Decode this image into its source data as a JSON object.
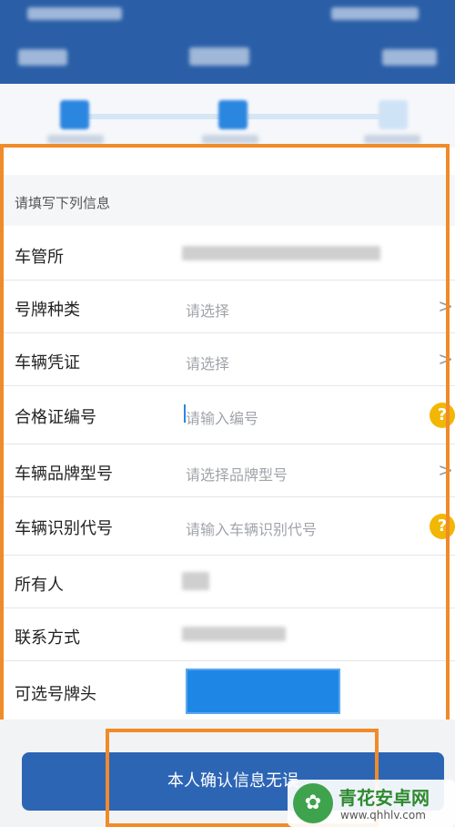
{
  "form": {
    "section_title": "请填写下列信息",
    "rows": [
      {
        "label": "车管所",
        "value": ""
      },
      {
        "label": "号牌种类",
        "value": "请选择"
      },
      {
        "label": "车辆凭证",
        "value": "请选择"
      },
      {
        "label": "合格证编号",
        "value": "请输入编号"
      },
      {
        "label": "车辆品牌型号",
        "value": "请选择品牌型号"
      },
      {
        "label": "车辆识别代号",
        "value": "请输入车辆识别代号"
      },
      {
        "label": "所有人",
        "value": ""
      },
      {
        "label": "联系方式",
        "value": ""
      },
      {
        "label": "可选号牌头",
        "value": ""
      }
    ],
    "chevron": ">",
    "help_symbol": "?"
  },
  "confirm_button": {
    "label": "本人确认信息无误"
  },
  "watermark": {
    "title": "青花安卓网",
    "url": "www.qhhlv.com",
    "logo_icon": "flower-icon"
  },
  "colors": {
    "header": "#2a5fa8",
    "primary": "#2d65b5",
    "highlight": "#f08b2a",
    "help": "#f2b705"
  }
}
